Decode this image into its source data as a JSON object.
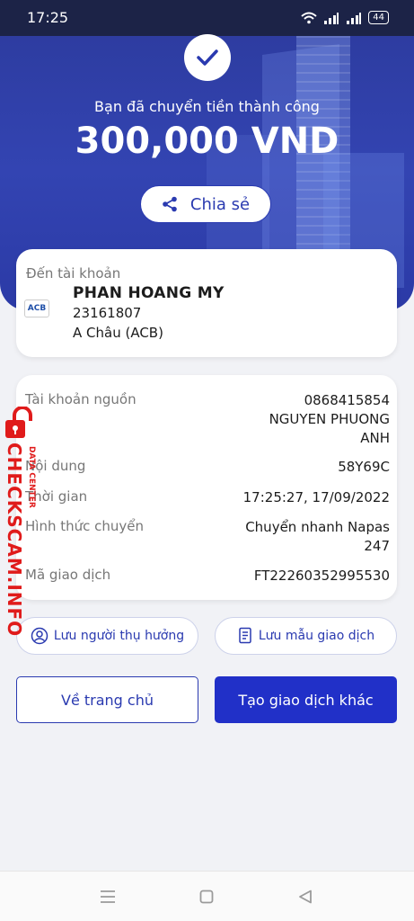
{
  "status_bar": {
    "time": "17:25",
    "battery": "44"
  },
  "hero": {
    "subtitle": "Bạn đã chuyển tiền thành công",
    "amount": "300,000 VND",
    "share_label": "Chia sẻ"
  },
  "destination": {
    "label": "Đến tài khoản",
    "bank_logo": "ACB",
    "name": "PHAN HOANG MY",
    "account": "23161807",
    "bank": "A Châu (ACB)"
  },
  "details": {
    "source_label": "Tài khoản nguồn",
    "source_account": "0868415854",
    "source_name_line1": "NGUYEN PHUONG",
    "source_name_line2": "ANH",
    "content_label": "Nội dung",
    "content_value": "58Y69C",
    "time_label": "Thời gian",
    "time_value": "17:25:27, 17/09/2022",
    "method_label": "Hình thức chuyển",
    "method_value_line1": "Chuyển nhanh Napas",
    "method_value_line2": "247",
    "txn_label": "Mã giao dịch",
    "txn_value": "FT22260352995530"
  },
  "actions": {
    "save_beneficiary": "Lưu người thụ hưởng",
    "save_template": "Lưu mẫu giao dịch",
    "home": "Về trang chủ",
    "new_transaction": "Tạo giao dịch khác"
  },
  "watermark": {
    "main": "CHECKSCAM.INFO",
    "sub": "DATA CENTER"
  },
  "colors": {
    "primary": "#2130c8",
    "hero": "#3344b2"
  }
}
